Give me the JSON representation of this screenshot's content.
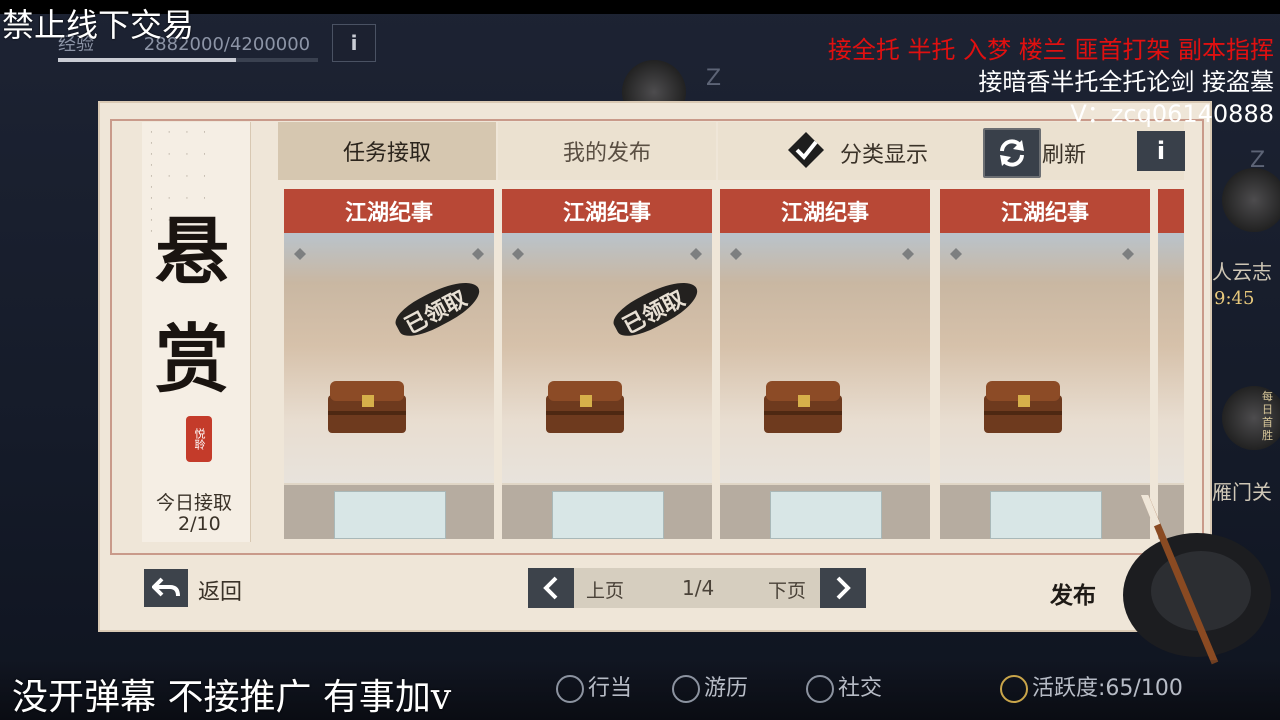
{
  "overlay": {
    "top_left": "禁止线下交易",
    "right_line1": "接全托 半托 入梦 楼兰 匪首打架 副本指挥",
    "right_line2": "接暗香半托全托论剑 接盗墓",
    "right_line3": "V：zcq06140888",
    "bottom_left": "没开弹幕 不接推广 有事加v"
  },
  "experience": {
    "label": "经验",
    "value": "2882000/4200000",
    "progress": 0.686,
    "info_label": "i"
  },
  "side": {
    "z1": "Z",
    "z2": "Z",
    "name_fragment": "人云志",
    "time_fragment": "9:45",
    "daily_fragment": "每日首胜",
    "gate_fragment": "雁门关"
  },
  "panel": {
    "title_char1": "悬",
    "title_char2": "赏",
    "seal_text": "悦聆",
    "today_label": "今日接取",
    "today_value": "2/10",
    "tabs": [
      {
        "label": "任务接取",
        "active": true
      },
      {
        "label": "我的发布",
        "active": false
      }
    ],
    "category_toggle_label": "分类显示",
    "refresh_label": "刷新",
    "info_label": "i",
    "cards": [
      {
        "title": "江湖纪事",
        "stamp": "已领取"
      },
      {
        "title": "江湖纪事",
        "stamp": "已领取"
      },
      {
        "title": "江湖纪事",
        "stamp": ""
      },
      {
        "title": "江湖纪事",
        "stamp": ""
      }
    ],
    "back_label": "返回",
    "prev_label": "上页",
    "page_indicator": "1/4",
    "next_label": "下页",
    "publish_label": "发布"
  },
  "bottom_nav": {
    "item1": "行当",
    "item2": "游历",
    "item3": "社交",
    "activity": "活跃度:65/100"
  },
  "colors": {
    "card_header": "#b84836",
    "panel_bg": "#efe6d8",
    "overlay_red": "#e01010"
  }
}
